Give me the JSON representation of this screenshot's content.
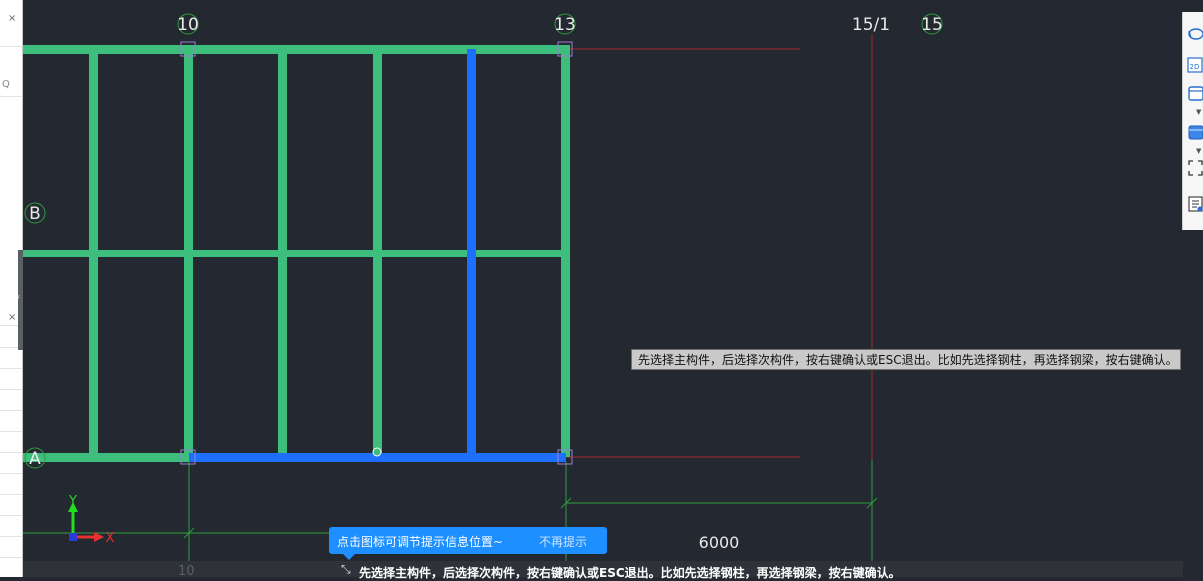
{
  "canvas": {
    "axis_labels": {
      "top": [
        "10",
        "13",
        "15/1",
        "15"
      ],
      "left": [
        "B",
        "A"
      ],
      "bottom_ghost": "10"
    },
    "dimension_label": "6000",
    "ucs": {
      "y_label": "Y",
      "x_label": "X"
    },
    "colors": {
      "background": "#242830",
      "member": "#3dbe7c",
      "selected_member": "#1f6fff",
      "axis_line": "#a52a2a",
      "dimension_line": "#2e9e3f",
      "axis_label": "#e8e8e8"
    }
  },
  "hint_box": {
    "text": "先选择主构件，后选择次构件，按右键确认或ESC退出。比如先选择钢柱，再选择钢梁，按右键确认。"
  },
  "tip_popup": {
    "text": "点击图标可调节提示信息位置~",
    "dismiss_label": "不再提示"
  },
  "status_bar": {
    "text": "先选择主构件，后选择次构件，按右键确认或ESC退出。比如先选择钢柱，再选择钢梁，按右键确认。"
  },
  "right_toolbar": {
    "buttons": [
      "view-rotate-icon",
      "2d-view-icon",
      "box-view-icon",
      "solid-view-icon",
      "select-frame-icon",
      "property-list-icon"
    ]
  },
  "left_panel": {
    "close_glyph": "×",
    "search_glyph": "Q",
    "collapse_glyph": "‹"
  }
}
